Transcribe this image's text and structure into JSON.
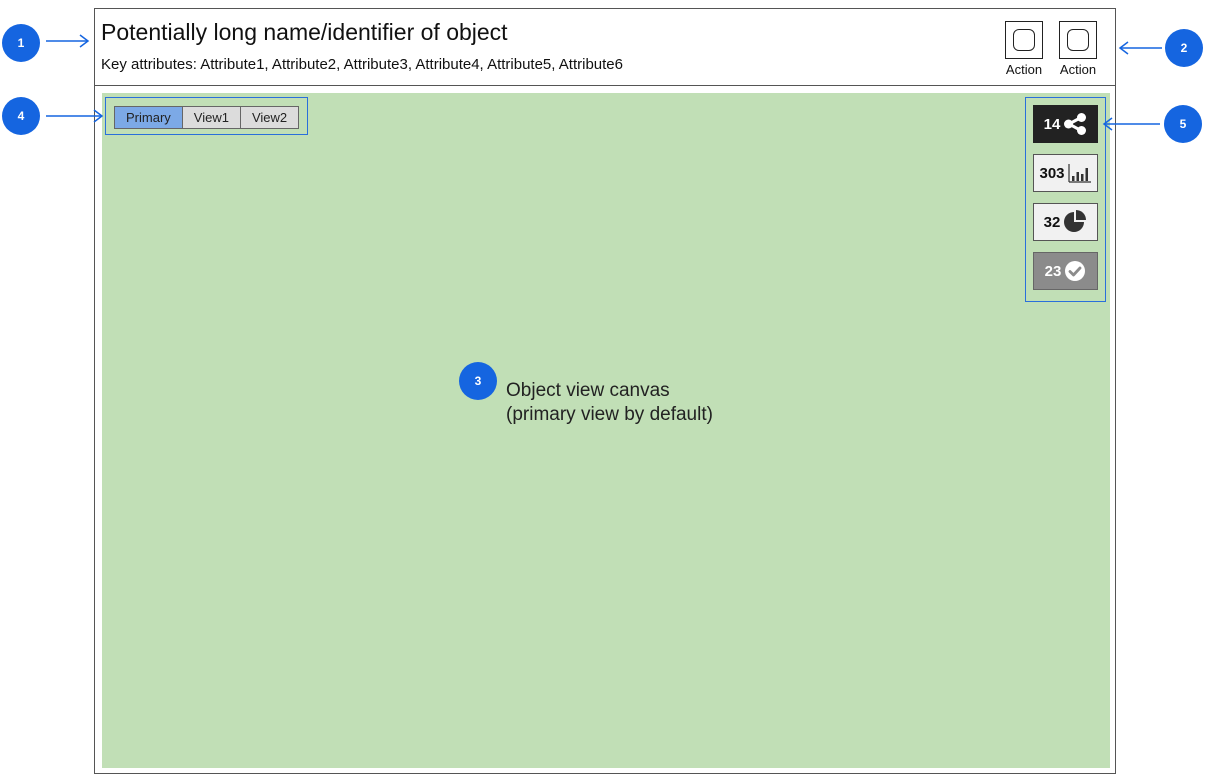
{
  "header": {
    "title": "Potentially long name/identifier of object",
    "key_attributes": "Key attributes: Attribute1, Attribute2, Attribute3, Attribute4, Attribute5, Attribute6",
    "actions": [
      {
        "label": "Action"
      },
      {
        "label": "Action"
      }
    ]
  },
  "view_tabs": [
    {
      "label": "Primary",
      "active": true
    },
    {
      "label": "View1",
      "active": false
    },
    {
      "label": "View2",
      "active": false
    }
  ],
  "stats": [
    {
      "value": "14",
      "icon": "share-icon",
      "style": "dark"
    },
    {
      "value": "303",
      "icon": "bar-chart-icon",
      "style": "light"
    },
    {
      "value": "32",
      "icon": "pie-chart-icon",
      "style": "light"
    },
    {
      "value": "23",
      "icon": "check-circle-icon",
      "style": "gray"
    }
  ],
  "canvas": {
    "label_line1": "Object view canvas",
    "label_line2": "(primary view by default)"
  },
  "callouts": [
    "1",
    "2",
    "3",
    "4",
    "5"
  ],
  "colors": {
    "callout": "#1565e0",
    "canvas": "#c1dfb6",
    "outline": "#2a6fdb",
    "active_tab": "#7ca9e6"
  }
}
